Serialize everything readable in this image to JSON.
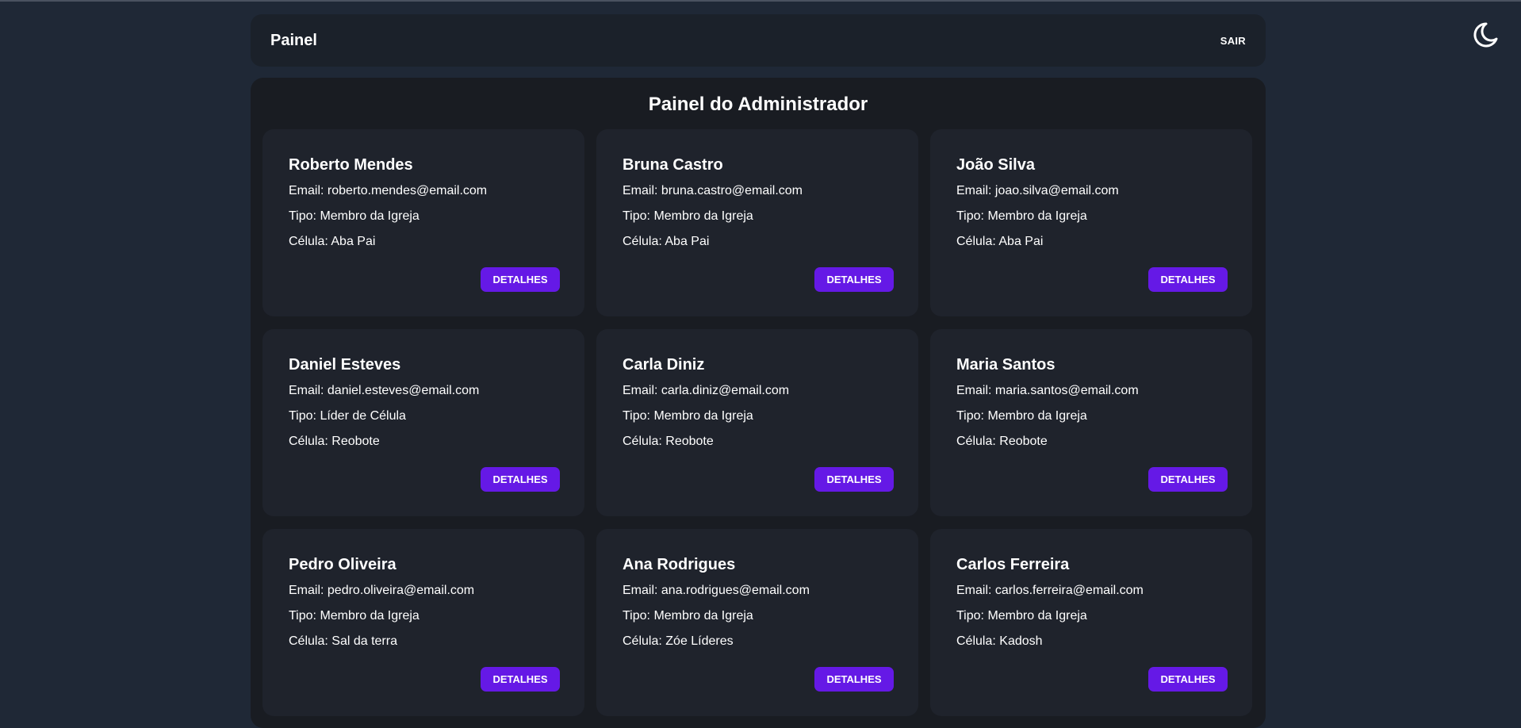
{
  "nav": {
    "title": "Painel",
    "logout_label": "SAIR"
  },
  "theme_toggle": {
    "icon": "moon-icon"
  },
  "panel": {
    "title": "Painel do Administrador"
  },
  "labels": {
    "email": "Email:",
    "tipo": "Tipo:",
    "celula": "Célula:",
    "details": "DETALHES"
  },
  "members": [
    {
      "name": "Roberto Mendes",
      "email": "roberto.mendes@email.com",
      "tipo": "Membro da Igreja",
      "celula": "Aba Pai"
    },
    {
      "name": "Bruna Castro",
      "email": "bruna.castro@email.com",
      "tipo": "Membro da Igreja",
      "celula": "Aba Pai"
    },
    {
      "name": "João Silva",
      "email": "joao.silva@email.com",
      "tipo": "Membro da Igreja",
      "celula": "Aba Pai"
    },
    {
      "name": "Daniel Esteves",
      "email": "daniel.esteves@email.com",
      "tipo": "Líder de Célula",
      "celula": "Reobote"
    },
    {
      "name": "Carla Diniz",
      "email": "carla.diniz@email.com",
      "tipo": "Membro da Igreja",
      "celula": "Reobote"
    },
    {
      "name": "Maria Santos",
      "email": "maria.santos@email.com",
      "tipo": "Membro da Igreja",
      "celula": "Reobote"
    },
    {
      "name": "Pedro Oliveira",
      "email": "pedro.oliveira@email.com",
      "tipo": "Membro da Igreja",
      "celula": "Sal da terra"
    },
    {
      "name": "Ana Rodrigues",
      "email": "ana.rodrigues@email.com",
      "tipo": "Membro da Igreja",
      "celula": "Zóe Líderes"
    },
    {
      "name": "Carlos Ferreira",
      "email": "carlos.ferreira@email.com",
      "tipo": "Membro da Igreja",
      "celula": "Kadosh"
    }
  ],
  "colors": {
    "background": "#1f2836",
    "panel": "#191c22",
    "card": "#1f232c",
    "accent": "#6519e6"
  }
}
